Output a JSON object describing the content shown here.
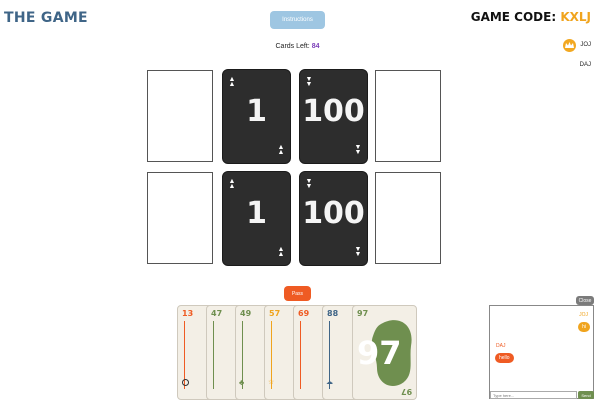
{
  "header": {
    "title": "THE GAME",
    "instructions_label": "Instructions",
    "game_code_label": "GAME CODE: ",
    "game_code": "KXLJ"
  },
  "status": {
    "cards_left_label": "Cards Left: ",
    "cards_left": "84"
  },
  "players": [
    {
      "name": "JOJ",
      "host": true
    },
    {
      "name": "DAJ",
      "host": false
    }
  ],
  "piles": [
    {
      "value": "1",
      "direction": "up"
    },
    {
      "value": "100",
      "direction": "down"
    },
    {
      "value": "1",
      "direction": "up"
    },
    {
      "value": "100",
      "direction": "down"
    }
  ],
  "pass_label": "Pass",
  "hand": [
    {
      "value": "13",
      "color": "#ef5b23"
    },
    {
      "value": "47",
      "color": "#6f8f4f"
    },
    {
      "value": "49",
      "color": "#6f8f4f"
    },
    {
      "value": "57",
      "color": "#f0a41e"
    },
    {
      "value": "69",
      "color": "#ef5b23"
    },
    {
      "value": "88",
      "color": "#3f6587"
    },
    {
      "value": "97",
      "color": "#6f8f4f"
    }
  ],
  "chat": {
    "close_label": "Close",
    "messages": [
      {
        "sender": "JOJ",
        "text": "hi",
        "mine": true
      },
      {
        "sender": "DAJ",
        "text": "hello",
        "mine": false
      }
    ],
    "input_placeholder": "Type here...",
    "send_label": "Send"
  },
  "colors": {
    "title": "#3f6587",
    "accent_orange": "#ef5b23",
    "accent_yellow": "#f0a41e",
    "green": "#6f8f4f",
    "pile_bg": "#2d2d2d",
    "instructions_bg": "#9ec6e2"
  }
}
